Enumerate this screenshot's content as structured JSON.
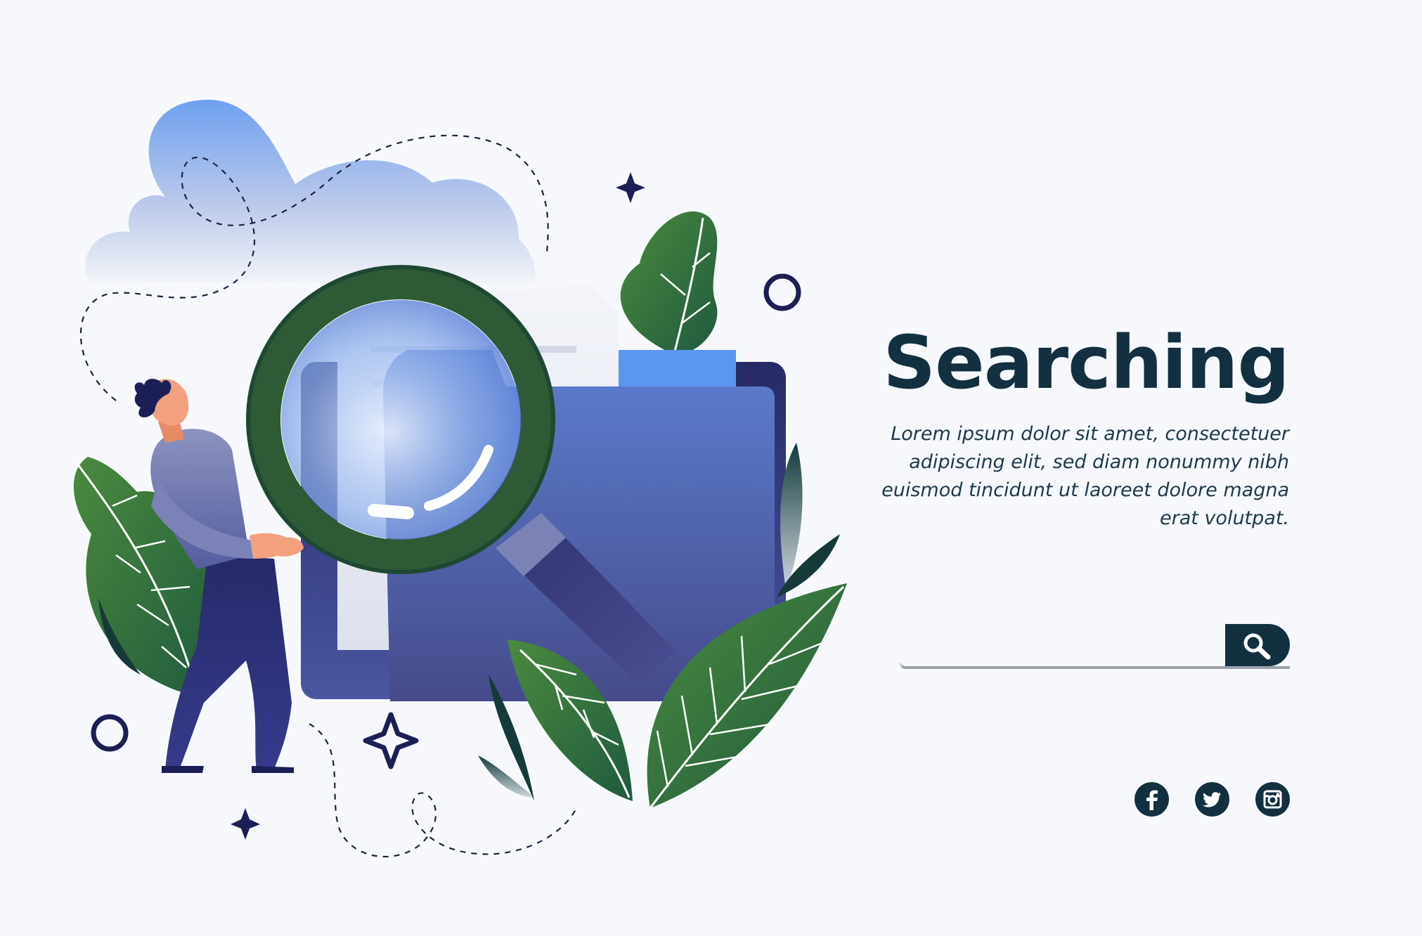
{
  "hero": {
    "title": "Searching",
    "description": "Lorem ipsum dolor sit amet, consectetuer adipiscing elit, sed diam nonummy nibh euismod tincidunt ut laoreet dolore magna erat volutpat."
  },
  "search": {
    "value": "",
    "placeholder": "",
    "button_icon": "magnifier-icon"
  },
  "social": {
    "items": [
      {
        "icon": "facebook-icon"
      },
      {
        "icon": "twitter-icon"
      },
      {
        "icon": "instagram-icon"
      }
    ]
  },
  "colors": {
    "background": "#f6f8fb",
    "title": "#12303f",
    "text": "#1d3a4a",
    "folder_blue": "#4f6ab8",
    "accent_blue": "#5b96f0",
    "leaf_green": "#3f7a3c",
    "lens_ring": "#2e5b35",
    "navy_star": "#1c1f55"
  },
  "illustration": {
    "icons": [
      "cloud-icon",
      "folder-icon",
      "magnifying-glass-icon",
      "person-icon",
      "leaf-icon",
      "sparkle-icon",
      "circle-icon"
    ]
  }
}
